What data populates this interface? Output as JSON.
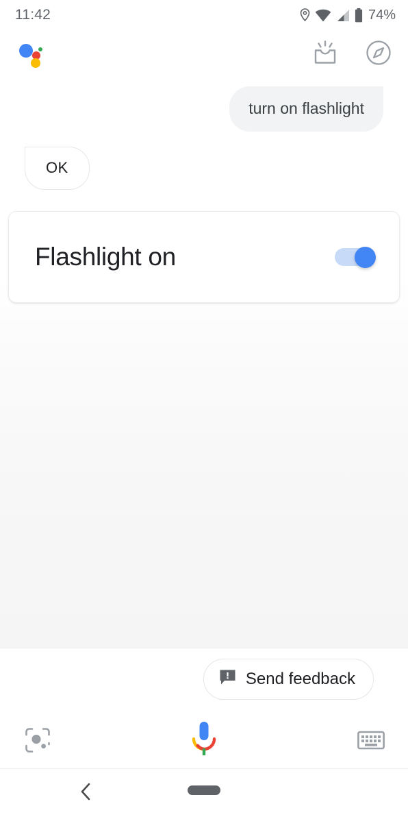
{
  "status_bar": {
    "time": "11:42",
    "battery_percent": "74%",
    "icons": [
      "location-pin-icon",
      "wifi-icon",
      "cellular-signal-icon",
      "battery-icon"
    ]
  },
  "header": {
    "logo": "google-assistant-logo",
    "actions": [
      {
        "name": "updates-inbox-icon",
        "label": "Updates"
      },
      {
        "name": "explore-compass-icon",
        "label": "Explore"
      }
    ]
  },
  "conversation": {
    "query": {
      "text": "turn on flashlight",
      "speaker": "user"
    },
    "response": {
      "text": "OK",
      "speaker": "assistant"
    },
    "card": {
      "title": "Flashlight on",
      "toggle": {
        "state": "on",
        "accent_color": "#4285F4",
        "track_color": "#c7daf8"
      }
    }
  },
  "footer": {
    "feedback": {
      "label": "Send feedback",
      "icon": "feedback-icon"
    },
    "input_bar": {
      "lens": "google-lens-icon",
      "mic": "google-mic-icon",
      "keyboard": "keyboard-icon"
    }
  },
  "nav_bar": {
    "back": "back-chevron-icon",
    "home": "home-pill-handle"
  },
  "colors": {
    "blue": "#4285F4",
    "red": "#EA4335",
    "yellow": "#FBBC05",
    "green": "#34A853",
    "text_primary": "#202124",
    "text_secondary": "#5f6368",
    "bubble_grey": "#f1f3f4"
  }
}
